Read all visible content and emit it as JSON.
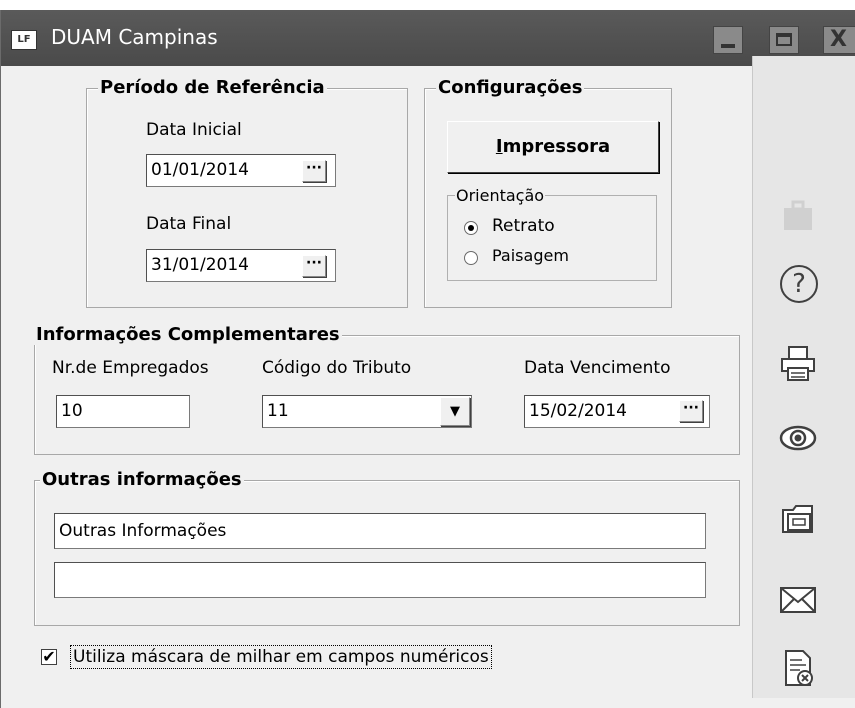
{
  "window": {
    "title": "DUAM Campinas",
    "app_icon_text": "LF",
    "close_glyph": "X"
  },
  "periodo": {
    "title": "Período de Referência",
    "data_inicial_label": "Data Inicial",
    "data_inicial_value": "01/01/2014",
    "data_final_label": "Data Final",
    "data_final_value": "31/01/2014",
    "ellipsis": "···"
  },
  "config": {
    "title": "Configurações",
    "impressora_underlined": "I",
    "impressora_rest": "mpressora",
    "orientacao_title": "Orientação",
    "retrato_label": "Retrato",
    "paisagem_label": "Paisagem",
    "selected": "Retrato"
  },
  "info": {
    "title": "Informações Complementares",
    "empregados_label": "Nr.de Empregados",
    "empregados_value": "10",
    "tributo_label": "Código do Tributo",
    "tributo_value": "11",
    "vencimento_label": "Data Vencimento",
    "vencimento_value": "15/02/2014",
    "dropdown_arrow": "▼",
    "ellipsis": "···"
  },
  "outras": {
    "title": "Outras informações",
    "line1_value": "Outras Informações",
    "line2_value": ""
  },
  "mascara": {
    "label": "Utiliza máscara de milhar em campos numéricos",
    "checked": true,
    "check_glyph": "✔"
  },
  "sidebar": {
    "help_glyph": "?"
  }
}
